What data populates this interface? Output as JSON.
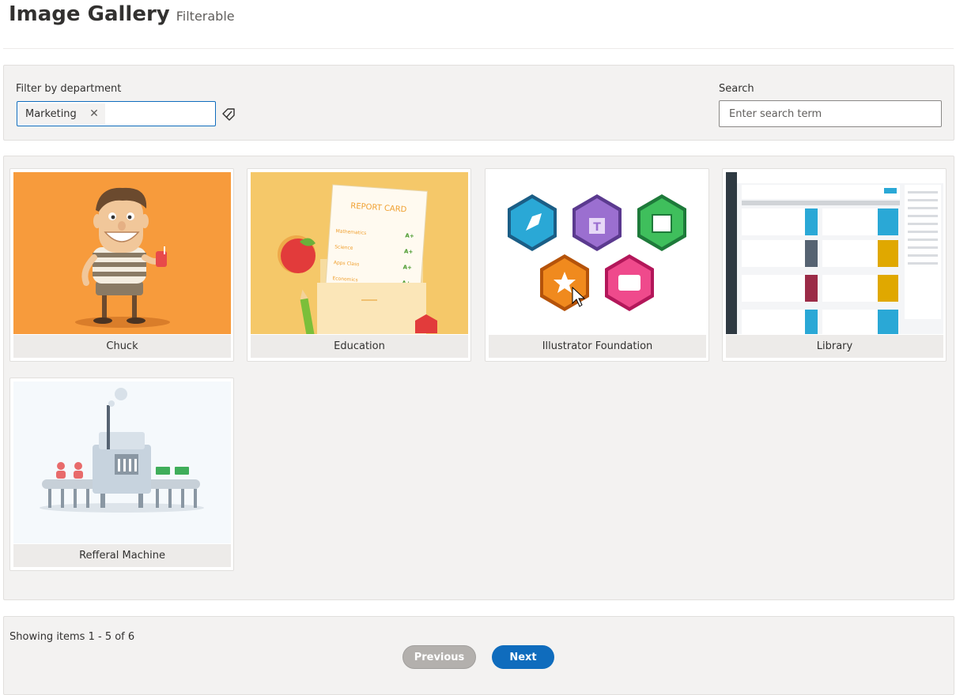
{
  "header": {
    "title": "Image Gallery",
    "subtitle": "Filterable"
  },
  "filter": {
    "label": "Filter by department",
    "selected_tag": "Marketing",
    "remove_tag_glyph": "✕",
    "clear_icon": "clear-filter-icon"
  },
  "search": {
    "label": "Search",
    "placeholder": "Enter search term",
    "value": ""
  },
  "gallery": {
    "items": [
      {
        "caption": "Chuck"
      },
      {
        "caption": "Education"
      },
      {
        "caption": "Illustrator Foundation"
      },
      {
        "caption": "Library"
      },
      {
        "caption": "Refferal Machine"
      }
    ],
    "report_card": {
      "heading": "REPORT CARD",
      "rows": [
        {
          "subject": "Mathematics",
          "grade": "A+"
        },
        {
          "subject": "Science",
          "grade": "A+"
        },
        {
          "subject": "Apps Class",
          "grade": "A+"
        },
        {
          "subject": "Economics",
          "grade": "A+"
        }
      ]
    }
  },
  "pagination": {
    "status": "Showing items 1 - 5 of 6",
    "previous": "Previous",
    "next": "Next"
  },
  "colors": {
    "accent": "#0f6cbd",
    "panel": "#f3f2f1",
    "chuck_bg": "#f79b3c",
    "education_bg": "#f5c869"
  }
}
